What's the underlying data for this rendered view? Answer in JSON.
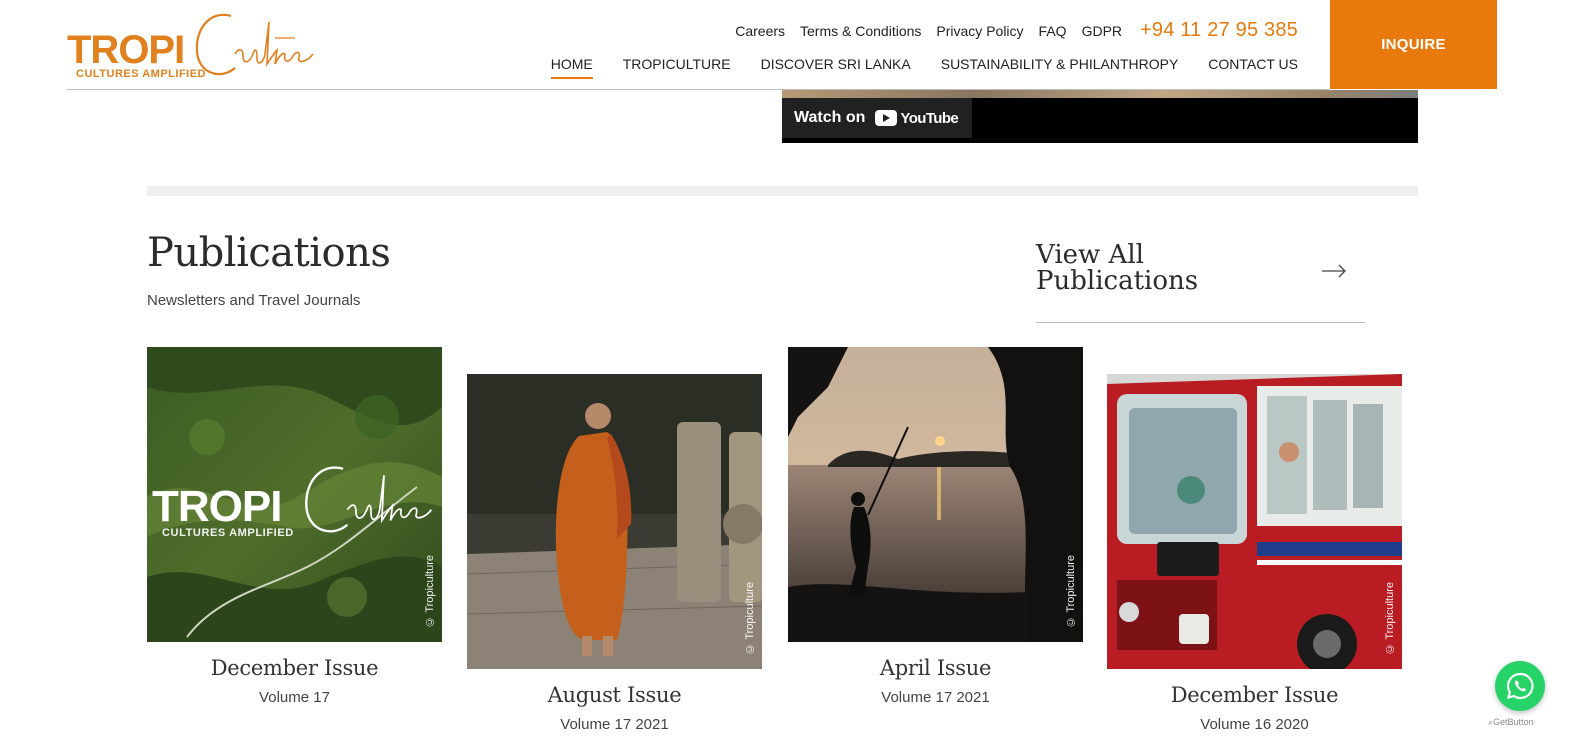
{
  "brand": {
    "logo_text": "TROPI",
    "logo_script": "Culture",
    "tagline": "CULTURES AMPLIFIED",
    "accent_color": "#e8790c"
  },
  "utility_nav": {
    "links": [
      "Careers",
      "Terms & Conditions",
      "Privacy Policy",
      "FAQ",
      "GDPR"
    ],
    "phone": "+94 11 27 95 385"
  },
  "main_nav": {
    "items": [
      "HOME",
      "TROPICULTURE",
      "DISCOVER SRI LANKA",
      "SUSTAINABILITY & PHILANTHROPY",
      "CONTACT US"
    ],
    "active": "HOME"
  },
  "inquire_label": "INQUIRE",
  "video": {
    "watch_label": "Watch on",
    "platform": "YouTube"
  },
  "publications": {
    "title": "Publications",
    "subtitle": "Newsletters and Travel Journals",
    "view_all": "View All Publications",
    "watermark": "© Tropiculture",
    "items": [
      {
        "title": "December Issue",
        "volume": "Volume 17",
        "image": "aerial-green-hills-with-logo"
      },
      {
        "title": "August Issue",
        "volume": "Volume 17 2021",
        "image": "monk-in-orange-robe"
      },
      {
        "title": "April Issue",
        "volume": "Volume 17 2021",
        "image": "sunset-lake-silhouette"
      },
      {
        "title": "December Issue",
        "volume": "Volume 16 2020",
        "image": "red-bus-kandy"
      }
    ]
  },
  "widgets": {
    "whatsapp_icon": "whatsapp-icon",
    "getbutton_label": "GetButton"
  }
}
